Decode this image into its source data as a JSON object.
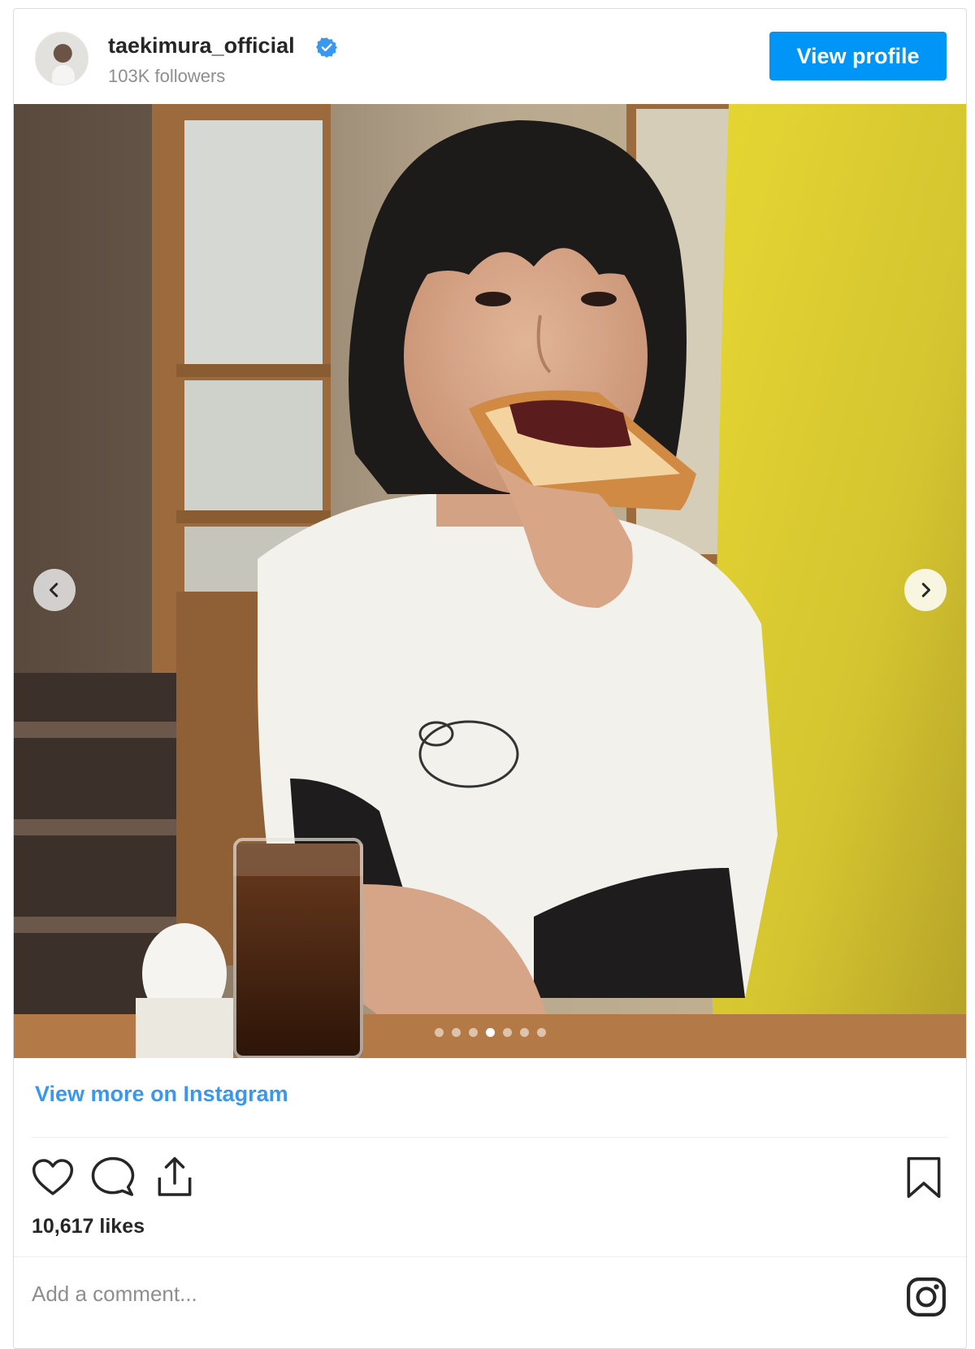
{
  "header": {
    "username": "taekimura_official",
    "followers": "103K followers",
    "view_profile_label": "View profile"
  },
  "carousel": {
    "slide_count": 7,
    "active_slide": 4
  },
  "footer": {
    "view_more_label": "View more on Instagram",
    "likes": "10,617 likes",
    "comment_placeholder": "Add a comment..."
  },
  "icons": {
    "verified": "verified-badge-icon",
    "prev": "chevron-left-icon",
    "next": "chevron-right-icon",
    "like": "heart-icon",
    "comment": "comment-bubble-icon",
    "share": "share-icon",
    "save": "bookmark-icon",
    "brand": "instagram-logo-icon"
  },
  "colors": {
    "accent": "#0095f6",
    "link": "#3897f0",
    "verified": "#3897f0"
  }
}
